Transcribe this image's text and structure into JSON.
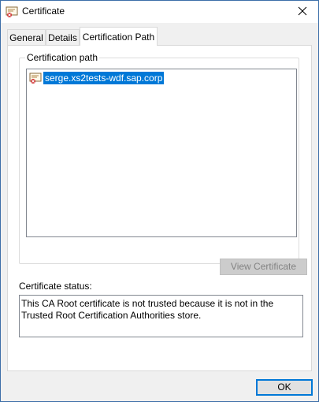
{
  "window": {
    "title": "Certificate",
    "title_icon": "certificate-icon",
    "close_icon": "close-icon"
  },
  "tabs": [
    {
      "label": "General",
      "active": false
    },
    {
      "label": "Details",
      "active": false
    },
    {
      "label": "Certification Path",
      "active": true
    }
  ],
  "certification_path": {
    "group_label": "Certification path",
    "items": [
      {
        "label": "serge.xs2tests-wdf.sap.corp",
        "icon": "certificate-error-icon",
        "selected": true
      }
    ],
    "view_button_label": "View Certificate",
    "view_button_enabled": false
  },
  "status": {
    "label": "Certificate status:",
    "text": "This CA Root certificate is not trusted because it is not in the Trusted Root Certification Authorities store."
  },
  "footer": {
    "ok_label": "OK"
  },
  "colors": {
    "accent": "#0078d7",
    "window_border": "#3c6ea8"
  }
}
